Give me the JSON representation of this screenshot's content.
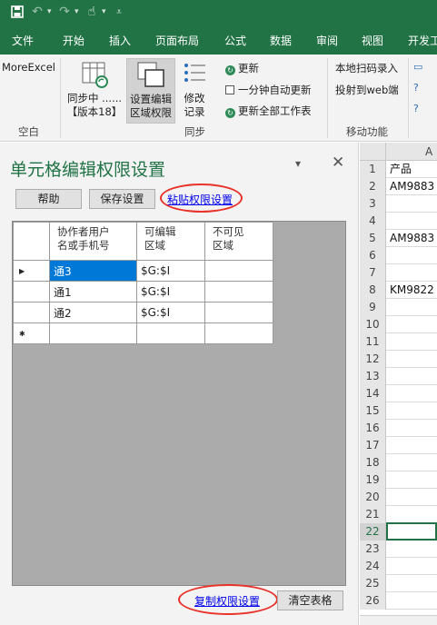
{
  "quick_access": {
    "save_icon": "save-icon",
    "undo_icon": "undo-icon",
    "redo_icon": "redo-icon",
    "touch_icon": "touch-mode-icon",
    "customize_icon": "customize-icon"
  },
  "tabs": [
    "文件",
    "开始",
    "插入",
    "页面布局",
    "公式",
    "数据",
    "审阅",
    "视图",
    "开发工"
  ],
  "ribbon": {
    "more_excel": "MoreExcel",
    "group_empty_label": "空白",
    "sync_button_line1": "同步中 ......",
    "sync_button_line2": "【版本18】",
    "set_edit_line1": "设置编辑",
    "set_edit_line2": "区域权限",
    "modify_line1": "修改",
    "modify_line2": "记录",
    "update": "更新",
    "auto_update": "一分钟自动更新",
    "update_all": "更新全部工作表",
    "group_sync_label": "同步",
    "local_scan": "本地扫码录入",
    "project_web": "投射到web端",
    "group_mobile_label": "移动功能"
  },
  "pane": {
    "title": "单元格编辑权限设置",
    "help_button": "帮助",
    "save_button": "保存设置",
    "paste_link": "粘贴权限设置",
    "copy_link": "复制权限设置",
    "clear_button": "清空表格",
    "columns": [
      "协作者用户\n名或手机号",
      "可编辑\n区域",
      "不可见\n区域"
    ],
    "rows": [
      {
        "user": "通3",
        "editable": "$G:$I",
        "hidden": ""
      },
      {
        "user": "通1",
        "editable": "$G:$I",
        "hidden": ""
      },
      {
        "user": "通2",
        "editable": "$G:$I",
        "hidden": ""
      }
    ]
  },
  "sheet": {
    "column_a": "A",
    "rows": [
      {
        "n": "1",
        "v": "产品"
      },
      {
        "n": "2",
        "v": "AM9883"
      },
      {
        "n": "3",
        "v": ""
      },
      {
        "n": "4",
        "v": ""
      },
      {
        "n": "5",
        "v": "AM9883"
      },
      {
        "n": "6",
        "v": ""
      },
      {
        "n": "7",
        "v": ""
      },
      {
        "n": "8",
        "v": "KM9822"
      },
      {
        "n": "9",
        "v": ""
      },
      {
        "n": "10",
        "v": ""
      },
      {
        "n": "11",
        "v": ""
      },
      {
        "n": "12",
        "v": ""
      },
      {
        "n": "13",
        "v": ""
      },
      {
        "n": "14",
        "v": ""
      },
      {
        "n": "15",
        "v": ""
      },
      {
        "n": "16",
        "v": ""
      },
      {
        "n": "17",
        "v": ""
      },
      {
        "n": "18",
        "v": ""
      },
      {
        "n": "19",
        "v": ""
      },
      {
        "n": "20",
        "v": ""
      },
      {
        "n": "21",
        "v": ""
      },
      {
        "n": "22",
        "v": ""
      },
      {
        "n": "23",
        "v": ""
      },
      {
        "n": "24",
        "v": ""
      },
      {
        "n": "25",
        "v": ""
      },
      {
        "n": "26",
        "v": ""
      }
    ],
    "active_row": "22"
  },
  "colors": {
    "brand": "#217346",
    "selection": "#0078d7",
    "highlight_oval": "#e8332a",
    "link": "#0000ee"
  }
}
